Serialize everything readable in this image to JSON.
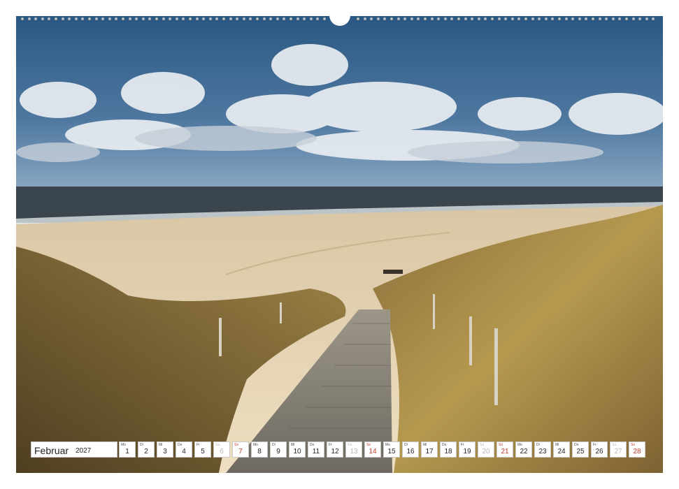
{
  "calendar": {
    "month": "Februar",
    "year": "2027",
    "days": [
      {
        "num": "1",
        "wd": "Mo",
        "kind": "week"
      },
      {
        "num": "2",
        "wd": "Di",
        "kind": "week"
      },
      {
        "num": "3",
        "wd": "Mi",
        "kind": "week"
      },
      {
        "num": "4",
        "wd": "Do",
        "kind": "week"
      },
      {
        "num": "5",
        "wd": "Fr",
        "kind": "week"
      },
      {
        "num": "6",
        "wd": "Sa",
        "kind": "sat"
      },
      {
        "num": "7",
        "wd": "So",
        "kind": "sun"
      },
      {
        "num": "8",
        "wd": "Mo",
        "kind": "week"
      },
      {
        "num": "9",
        "wd": "Di",
        "kind": "week"
      },
      {
        "num": "10",
        "wd": "Mi",
        "kind": "week"
      },
      {
        "num": "11",
        "wd": "Do",
        "kind": "week"
      },
      {
        "num": "12",
        "wd": "Fr",
        "kind": "week"
      },
      {
        "num": "13",
        "wd": "Sa",
        "kind": "sat"
      },
      {
        "num": "14",
        "wd": "So",
        "kind": "sun"
      },
      {
        "num": "15",
        "wd": "Mo",
        "kind": "week"
      },
      {
        "num": "16",
        "wd": "Di",
        "kind": "week"
      },
      {
        "num": "17",
        "wd": "Mi",
        "kind": "week"
      },
      {
        "num": "18",
        "wd": "Do",
        "kind": "week"
      },
      {
        "num": "19",
        "wd": "Fr",
        "kind": "week"
      },
      {
        "num": "20",
        "wd": "Sa",
        "kind": "sat"
      },
      {
        "num": "21",
        "wd": "So",
        "kind": "sun"
      },
      {
        "num": "22",
        "wd": "Mo",
        "kind": "week"
      },
      {
        "num": "23",
        "wd": "Di",
        "kind": "week"
      },
      {
        "num": "24",
        "wd": "Mi",
        "kind": "week"
      },
      {
        "num": "25",
        "wd": "Do",
        "kind": "week"
      },
      {
        "num": "26",
        "wd": "Fr",
        "kind": "week"
      },
      {
        "num": "27",
        "wd": "Sa",
        "kind": "sat"
      },
      {
        "num": "28",
        "wd": "So",
        "kind": "sun"
      }
    ]
  },
  "colors": {
    "sky_top": "#2c5a86",
    "sky_bottom": "#6f93b4",
    "sea": "#3d4750",
    "sand": "#e6d3b1",
    "grass": "#a98b4d",
    "sunday": "#c0392b"
  }
}
